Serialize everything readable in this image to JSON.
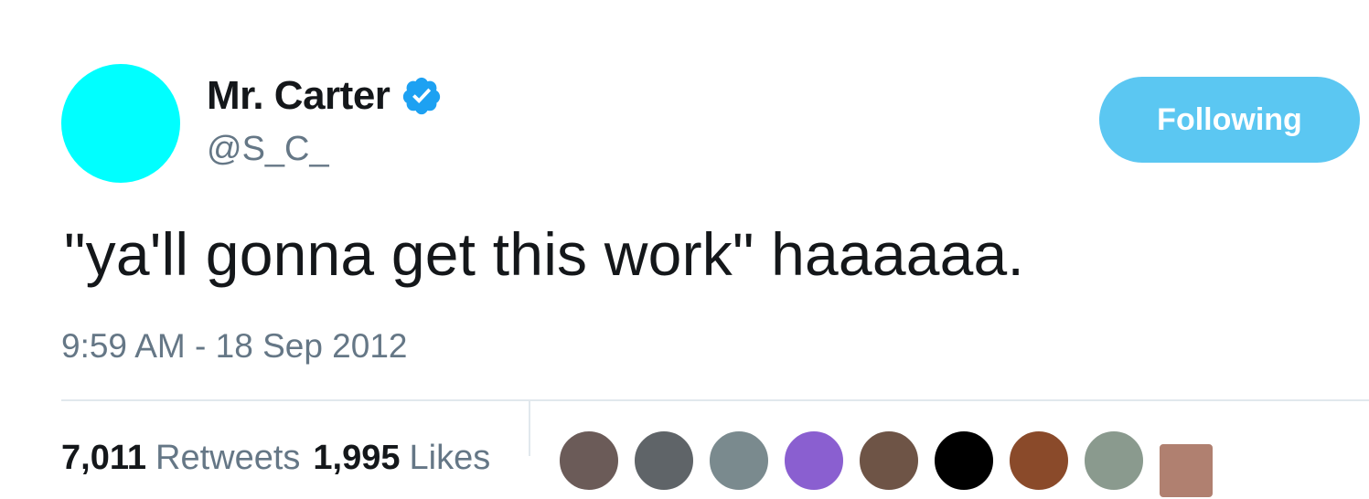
{
  "user": {
    "display_name": "Mr. Carter",
    "handle": "@S_C_",
    "verified": true,
    "avatar_color": "#00ffff"
  },
  "follow_button": {
    "label": "Following",
    "color": "#5bc7f2"
  },
  "tweet": {
    "text": "\"ya'll gonna get this work\" haaaaaa.",
    "timestamp": "9:59 AM - 18 Sep 2012"
  },
  "stats": {
    "retweets_count": "7,011",
    "retweets_label": "Retweets",
    "likes_count": "1,995",
    "likes_label": "Likes"
  },
  "likers": [
    {
      "icon": "avatar-icon",
      "color": "#6b5b58"
    },
    {
      "icon": "avatar-icon",
      "color": "#5f6468"
    },
    {
      "icon": "avatar-icon",
      "color": "#7a8a8e"
    },
    {
      "icon": "avatar-icon",
      "color": "#8a5fd0"
    },
    {
      "icon": "avatar-icon",
      "color": "#6e5446"
    },
    {
      "icon": "avatar-icon",
      "color": "#000000"
    },
    {
      "icon": "avatar-icon",
      "color": "#8a4a2a"
    },
    {
      "icon": "avatar-icon",
      "color": "#8a9a8e"
    },
    {
      "icon": "avatar-icon",
      "color": "#b08070"
    }
  ],
  "colors": {
    "text_primary": "#14171a",
    "text_secondary": "#657786",
    "verified_blue": "#1da1f2",
    "divider": "#e1e8ed"
  }
}
